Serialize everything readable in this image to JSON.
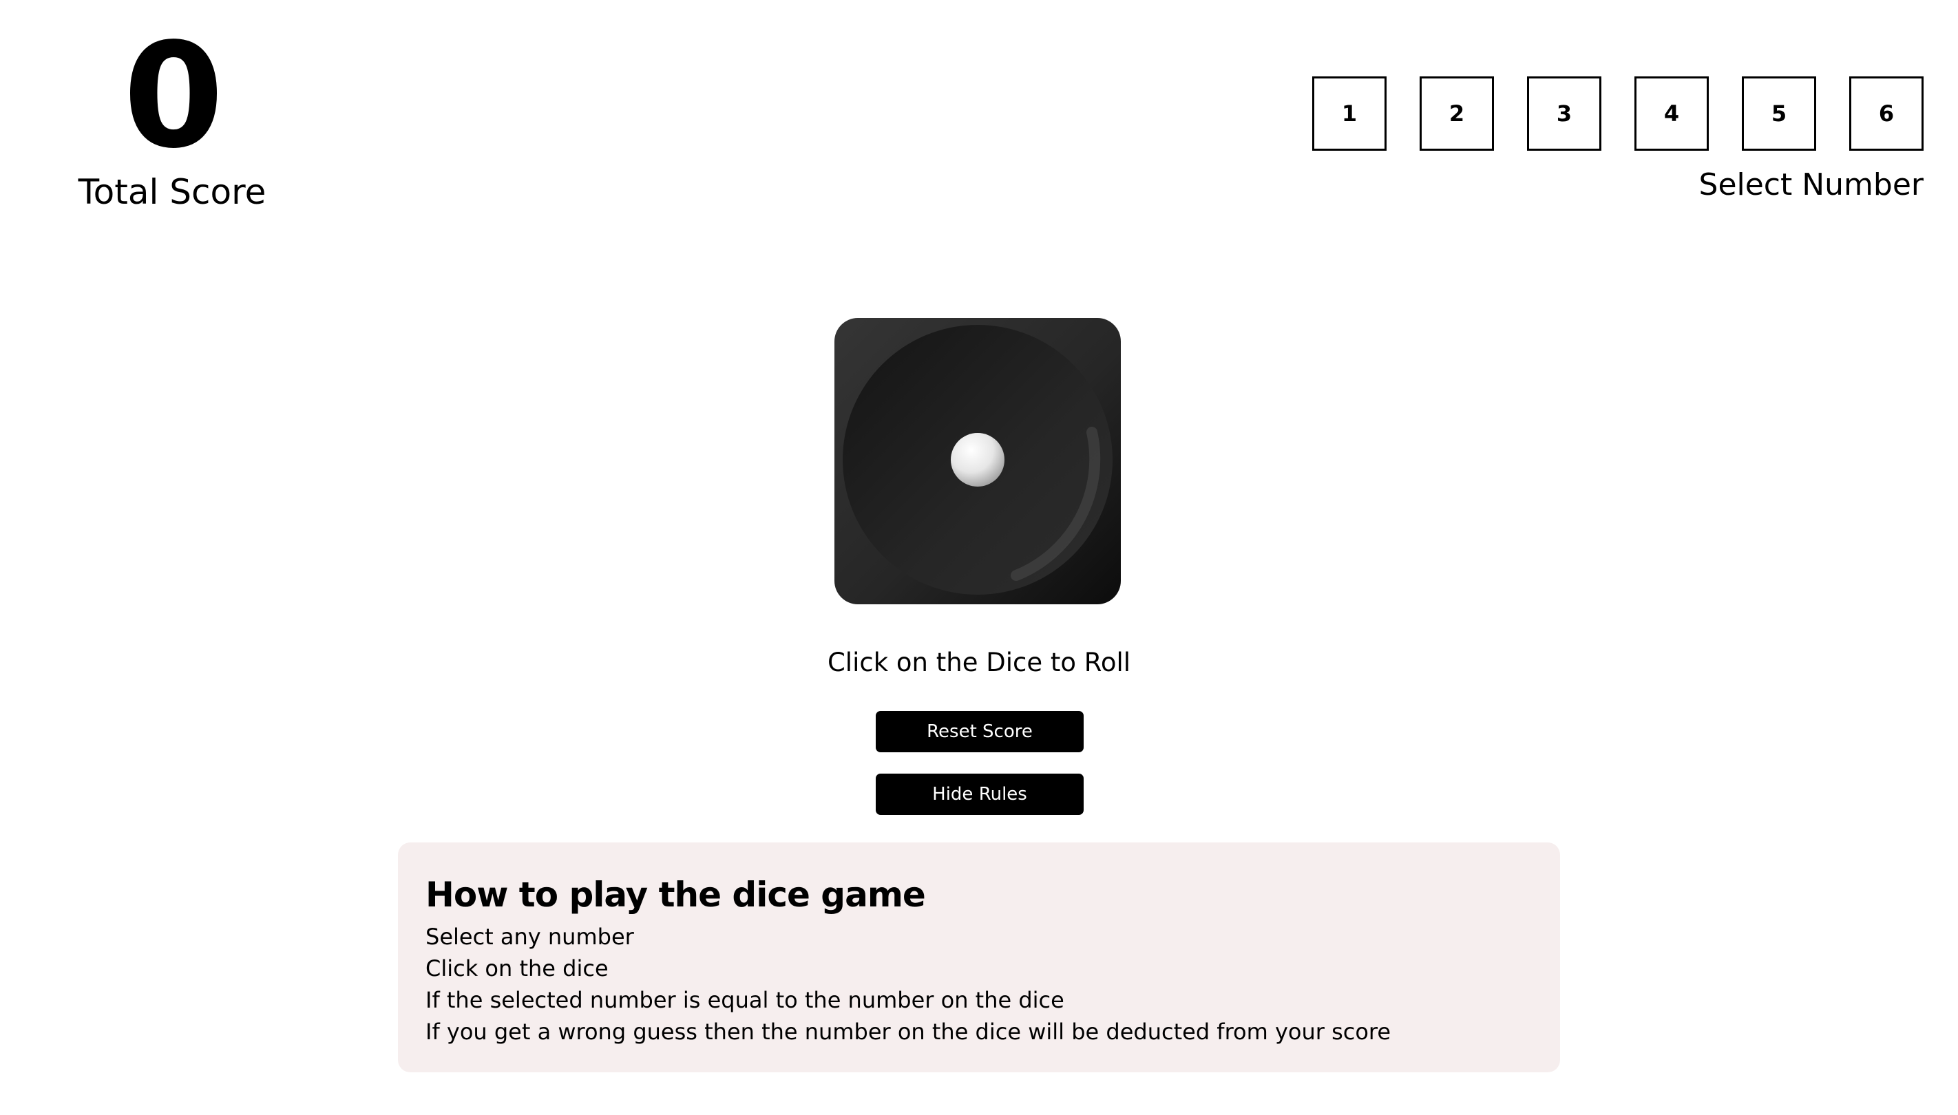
{
  "score": {
    "value": "0",
    "label": "Total Score"
  },
  "selector": {
    "numbers": [
      "1",
      "2",
      "3",
      "4",
      "5",
      "6"
    ],
    "label": "Select Number"
  },
  "dice": {
    "face": 1,
    "icon": "dice-one-icon"
  },
  "roll_hint": "Click on the Dice to Roll",
  "buttons": {
    "reset": "Reset Score",
    "rules": "Hide Rules"
  },
  "rules": {
    "title": "How to play the dice game",
    "lines": [
      "Select any number",
      "Click on the dice",
      "If the selected number is equal to the number on the dice",
      "If you get a wrong guess then the number on the dice will be deducted from your score"
    ]
  },
  "colors": {
    "button_bg": "#000000",
    "rules_bg": "#f6eeee",
    "dice_body": "#1e1e1e"
  }
}
